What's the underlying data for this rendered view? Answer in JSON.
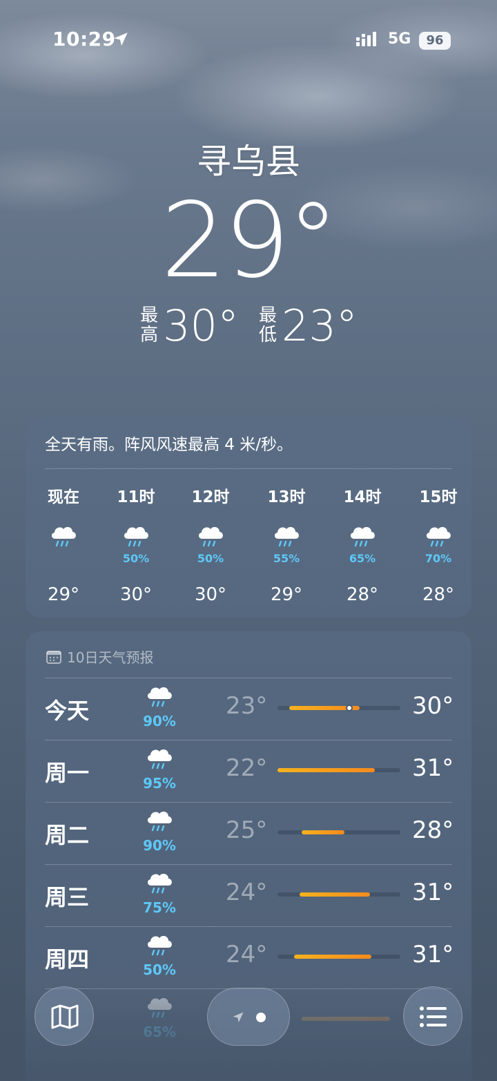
{
  "status_bar": {
    "time": "10:29",
    "network": "5G",
    "battery": "96"
  },
  "header": {
    "city": "寻乌县",
    "temperature": "29°",
    "high_label": "最高",
    "high_value": "30°",
    "low_label": "最低",
    "low_value": "23°"
  },
  "hourly": {
    "summary": "全天有雨。阵风风速最高 4 米/秒。",
    "items": [
      {
        "label": "现在",
        "icon": "rain-cloud-icon",
        "pct": "",
        "temp": "29°"
      },
      {
        "label": "11时",
        "icon": "rain-cloud-icon",
        "pct": "50%",
        "temp": "30°"
      },
      {
        "label": "12时",
        "icon": "rain-cloud-icon",
        "pct": "50%",
        "temp": "30°"
      },
      {
        "label": "13时",
        "icon": "rain-cloud-icon",
        "pct": "55%",
        "temp": "29°"
      },
      {
        "label": "14时",
        "icon": "rain-cloud-icon",
        "pct": "65%",
        "temp": "28°"
      },
      {
        "label": "15时",
        "icon": "rain-cloud-icon",
        "pct": "70%",
        "temp": "28°"
      }
    ]
  },
  "daily": {
    "title": "10日天气预报",
    "items": [
      {
        "day": "今天",
        "icon": "rain-cloud-icon",
        "pct": "90%",
        "low": "23°",
        "high": "30°"
      },
      {
        "day": "周一",
        "icon": "rain-cloud-icon",
        "pct": "95%",
        "low": "22°",
        "high": "31°"
      },
      {
        "day": "周二",
        "icon": "rain-cloud-icon",
        "pct": "90%",
        "low": "25°",
        "high": "28°"
      },
      {
        "day": "周三",
        "icon": "rain-cloud-icon",
        "pct": "75%",
        "low": "24°",
        "high": "31°"
      },
      {
        "day": "周四",
        "icon": "rain-cloud-icon",
        "pct": "50%",
        "low": "24°",
        "high": "31°"
      },
      {
        "day": "",
        "icon": "rain-cloud-icon",
        "pct": "65%",
        "low": "",
        "high": ""
      }
    ]
  },
  "colors": {
    "accent_precip": "#5ec8f8",
    "bar_warm": "#f5a21e"
  }
}
